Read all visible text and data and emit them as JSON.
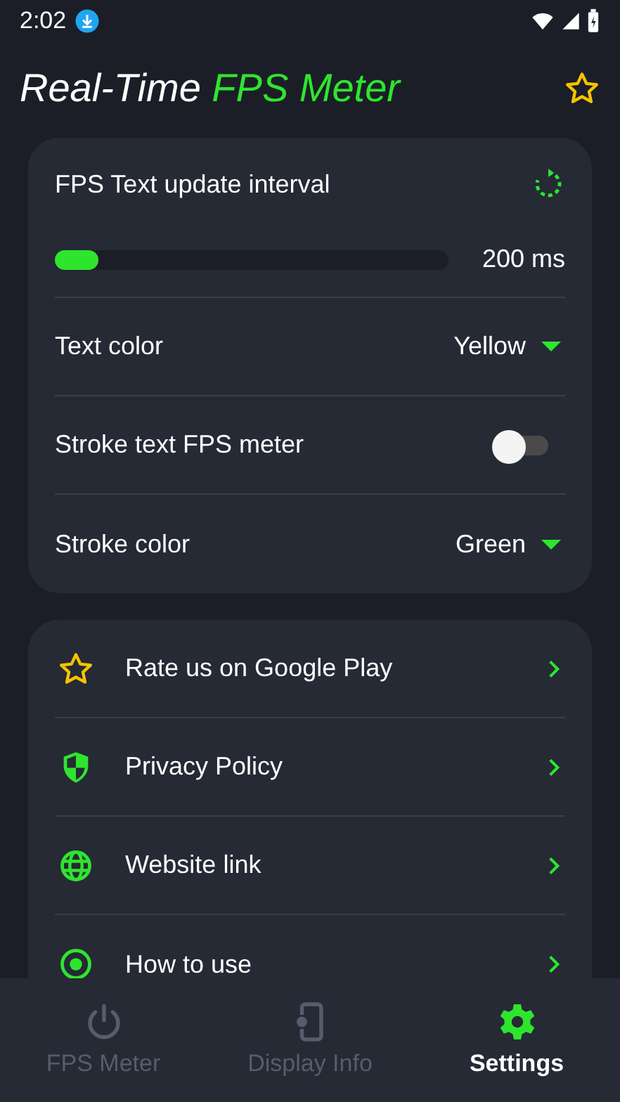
{
  "status_bar": {
    "time": "2:02"
  },
  "app_bar": {
    "title": "Real-Time **FPS Meter**"
  },
  "settings": [
    {
      "kind": "slider",
      "label": "FPS Text update interval",
      "level": 0.11,
      "reading": "200 ms"
    },
    {
      "kind": "dropdown",
      "label": "Text color",
      "value": "Yellow"
    },
    {
      "kind": "toggle",
      "label": "Stroke text FPS meter",
      "on": false
    },
    {
      "kind": "dropdown",
      "label": "Stroke color",
      "value": "Green"
    }
  ],
  "links": [
    {
      "label": "Rate us on Google Play"
    },
    {
      "label": "Privacy Policy"
    },
    {
      "label": "Website link"
    },
    {
      "label": "How to use"
    }
  ],
  "tabs": [
    {
      "label": "FPS Meter",
      "selected": false
    },
    {
      "label": "Display Info",
      "selected": false
    },
    {
      "label": "Settings",
      "selected": true
    }
  ]
}
